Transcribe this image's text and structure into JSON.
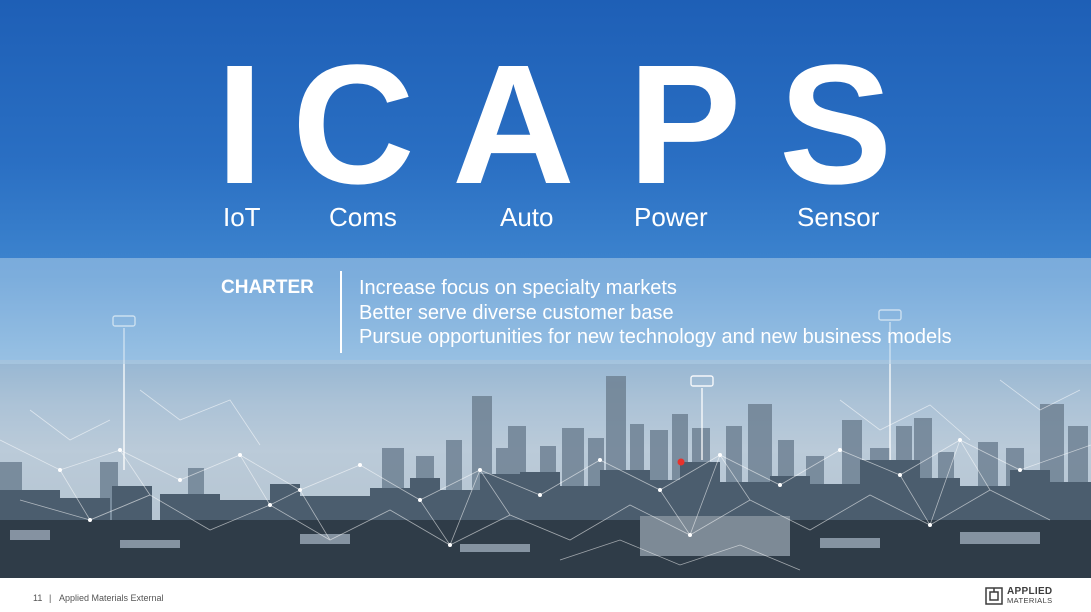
{
  "acronym": {
    "letters": [
      "I",
      "C",
      "A",
      "P",
      "S"
    ],
    "words": [
      "IoT",
      "Coms",
      "Auto",
      "Power",
      "Sensor"
    ]
  },
  "charter": {
    "label": "CHARTER",
    "points": [
      "Increase focus on specialty markets",
      "Better serve diverse customer base",
      "Pursue opportunities for new technology and new business models"
    ]
  },
  "footer": {
    "page_number": "11",
    "separator": "|",
    "classification": "Applied Materials External",
    "logo_line1": "APPLIED",
    "logo_line2": "MATERIALS"
  },
  "colors": {
    "sky_top": "#1e5fb6",
    "text": "#ffffff",
    "footer_text": "#555555"
  }
}
